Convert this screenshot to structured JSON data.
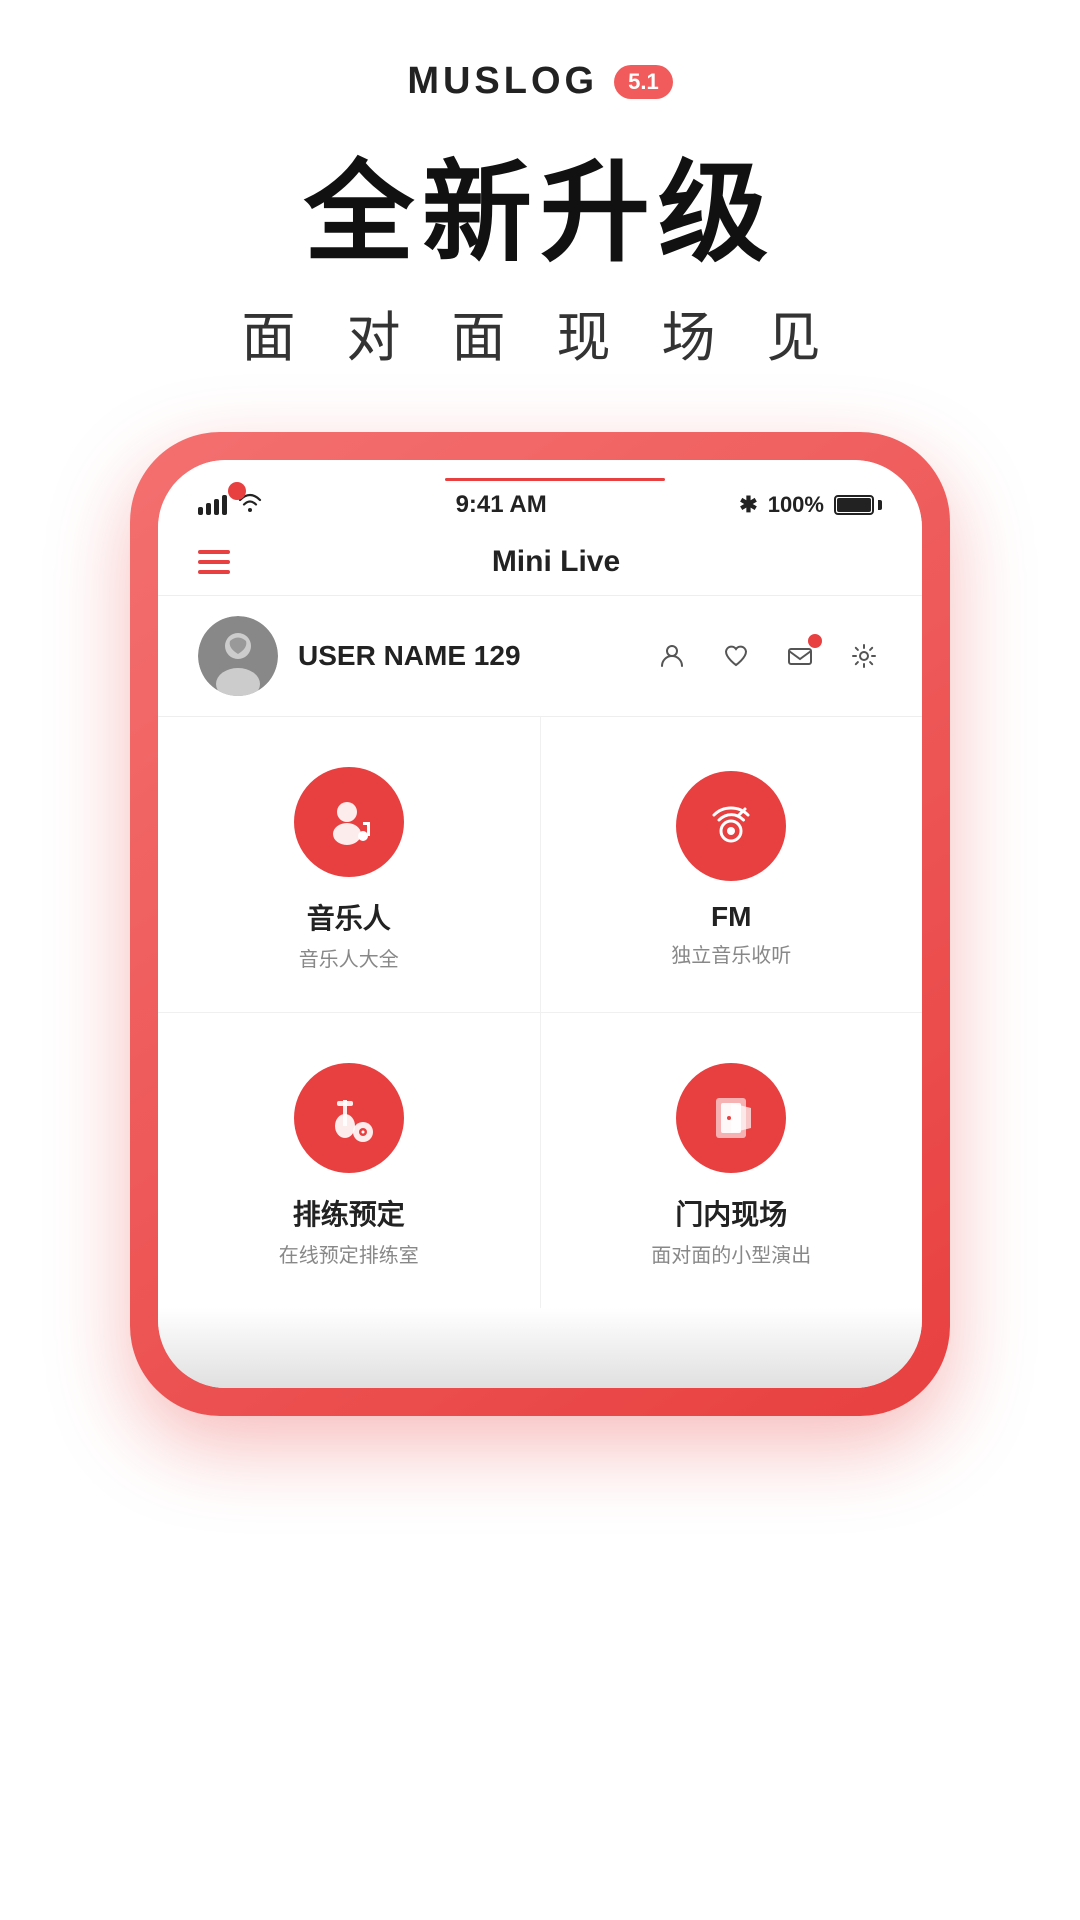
{
  "app": {
    "name": "MUSLOG",
    "version": "5.1",
    "main_title": "全新升级",
    "sub_title": "面 对 面   现 场 见"
  },
  "status_bar": {
    "time": "9:41 AM",
    "battery": "100%",
    "bluetooth": "✱"
  },
  "header": {
    "title": "Mini Live",
    "menu_icon": "hamburger"
  },
  "user": {
    "name": "USER NAME 129",
    "icons": [
      "person",
      "heart",
      "mail",
      "settings"
    ]
  },
  "grid": [
    {
      "icon": "musician",
      "title": "音乐人",
      "subtitle": "音乐人大全"
    },
    {
      "icon": "fm",
      "title": "FM",
      "subtitle": "独立音乐收听"
    },
    {
      "icon": "rehearsal",
      "title": "排练预定",
      "subtitle": "在线预定排练室"
    },
    {
      "icon": "venue",
      "title": "门内现场",
      "subtitle": "面对面的小型演出"
    }
  ],
  "colors": {
    "accent": "#e84040",
    "text_primary": "#222222",
    "text_secondary": "#888888"
  }
}
